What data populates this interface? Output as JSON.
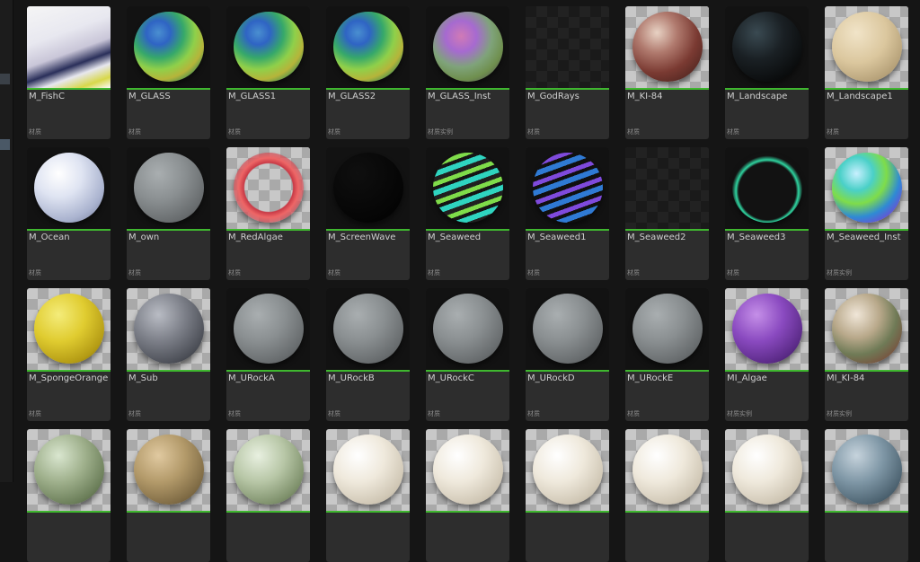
{
  "assets": [
    {
      "name": "",
      "type": "材质",
      "thumb": "dark",
      "ball": ""
    },
    {
      "name": "",
      "type": "材质",
      "thumb": "dark",
      "ball": ""
    },
    {
      "name": "",
      "type": "材质",
      "thumb": "dark",
      "ball": ""
    },
    {
      "name": "",
      "type": "材质",
      "thumb": "dark",
      "ball": ""
    },
    {
      "name": "",
      "type": "材质",
      "thumb": "dark",
      "ball": ""
    },
    {
      "name": "",
      "type": "材质",
      "thumb": "dark",
      "ball": ""
    },
    {
      "name": "",
      "type": "材质",
      "thumb": "dark",
      "ball": ""
    },
    {
      "name": "",
      "type": "材质",
      "thumb": "dark",
      "ball": ""
    },
    {
      "name": "",
      "type": "材质",
      "thumb": "dark",
      "ball": ""
    },
    {
      "name": "M_FishC",
      "type": "材质",
      "thumb": "fish",
      "ball": ""
    },
    {
      "name": "M_GLASS",
      "type": "材质",
      "thumb": "dark",
      "ball": "glass"
    },
    {
      "name": "M_GLASS1",
      "type": "材质",
      "thumb": "dark",
      "ball": "glass"
    },
    {
      "name": "M_GLASS2",
      "type": "材质",
      "thumb": "dark",
      "ball": "glass"
    },
    {
      "name": "M_GLASS_Inst",
      "type": "材质实例",
      "thumb": "dark",
      "ball": "glassinst"
    },
    {
      "name": "M_GodRays",
      "type": "材质",
      "thumb": "darkchecker",
      "ball": ""
    },
    {
      "name": "M_KI-84",
      "type": "材质",
      "thumb": "checker",
      "ball": "ki84"
    },
    {
      "name": "M_Landscape",
      "type": "材质",
      "thumb": "dark",
      "ball": "landscape"
    },
    {
      "name": "M_Landscape1",
      "type": "材质",
      "thumb": "checker",
      "ball": "sand"
    },
    {
      "name": "M_Ocean",
      "type": "材质",
      "thumb": "dark",
      "ball": "ocean"
    },
    {
      "name": "M_own",
      "type": "材质",
      "thumb": "dark",
      "ball": "grey"
    },
    {
      "name": "M_RedAlgae",
      "type": "材质",
      "thumb": "checker",
      "ball": "redalgae"
    },
    {
      "name": "M_ScreenWave",
      "type": "材质",
      "thumb": "dark",
      "ball": "black"
    },
    {
      "name": "M_Seaweed",
      "type": "材质",
      "thumb": "dark",
      "ball": "seaweed"
    },
    {
      "name": "M_Seaweed1",
      "type": "材质",
      "thumb": "dark",
      "ball": "seaweed1"
    },
    {
      "name": "M_Seaweed2",
      "type": "材质",
      "thumb": "darkchecker",
      "ball": ""
    },
    {
      "name": "M_Seaweed3",
      "type": "材质",
      "thumb": "dark",
      "ball": "seaweed3"
    },
    {
      "name": "M_Seaweed_Inst",
      "type": "材质实例",
      "thumb": "checker",
      "ball": "seaweedinst"
    },
    {
      "name": "M_SpongeOrange",
      "type": "材质",
      "thumb": "checker",
      "ball": "sponge"
    },
    {
      "name": "M_Sub",
      "type": "材质",
      "thumb": "checker",
      "ball": "sub"
    },
    {
      "name": "M_URockA",
      "type": "材质",
      "thumb": "dark",
      "ball": "grey"
    },
    {
      "name": "M_URockB",
      "type": "材质",
      "thumb": "dark",
      "ball": "grey"
    },
    {
      "name": "M_URockC",
      "type": "材质",
      "thumb": "dark",
      "ball": "grey"
    },
    {
      "name": "M_URockD",
      "type": "材质",
      "thumb": "dark",
      "ball": "grey"
    },
    {
      "name": "M_URockE",
      "type": "材质",
      "thumb": "dark",
      "ball": "grey"
    },
    {
      "name": "MI_Algae",
      "type": "材质实例",
      "thumb": "checker",
      "ball": "algae"
    },
    {
      "name": "MI_KI-84",
      "type": "材质实例",
      "thumb": "checker",
      "ball": "miki84"
    },
    {
      "name": "",
      "type": "",
      "thumb": "checker",
      "ball": "greenrock"
    },
    {
      "name": "",
      "type": "",
      "thumb": "checker",
      "ball": "tanrock"
    },
    {
      "name": "",
      "type": "",
      "thumb": "checker",
      "ball": "greenrock2"
    },
    {
      "name": "",
      "type": "",
      "thumb": "checker",
      "ball": "white"
    },
    {
      "name": "",
      "type": "",
      "thumb": "checker",
      "ball": "white"
    },
    {
      "name": "",
      "type": "",
      "thumb": "checker",
      "ball": "white"
    },
    {
      "name": "",
      "type": "",
      "thumb": "checker",
      "ball": "white"
    },
    {
      "name": "",
      "type": "",
      "thumb": "checker",
      "ball": "white"
    },
    {
      "name": "",
      "type": "",
      "thumb": "checker",
      "ball": "bluegrey"
    }
  ],
  "colors": {
    "accent": "#3fb72f",
    "tile": "#2d2d2d",
    "background": "#151515"
  }
}
